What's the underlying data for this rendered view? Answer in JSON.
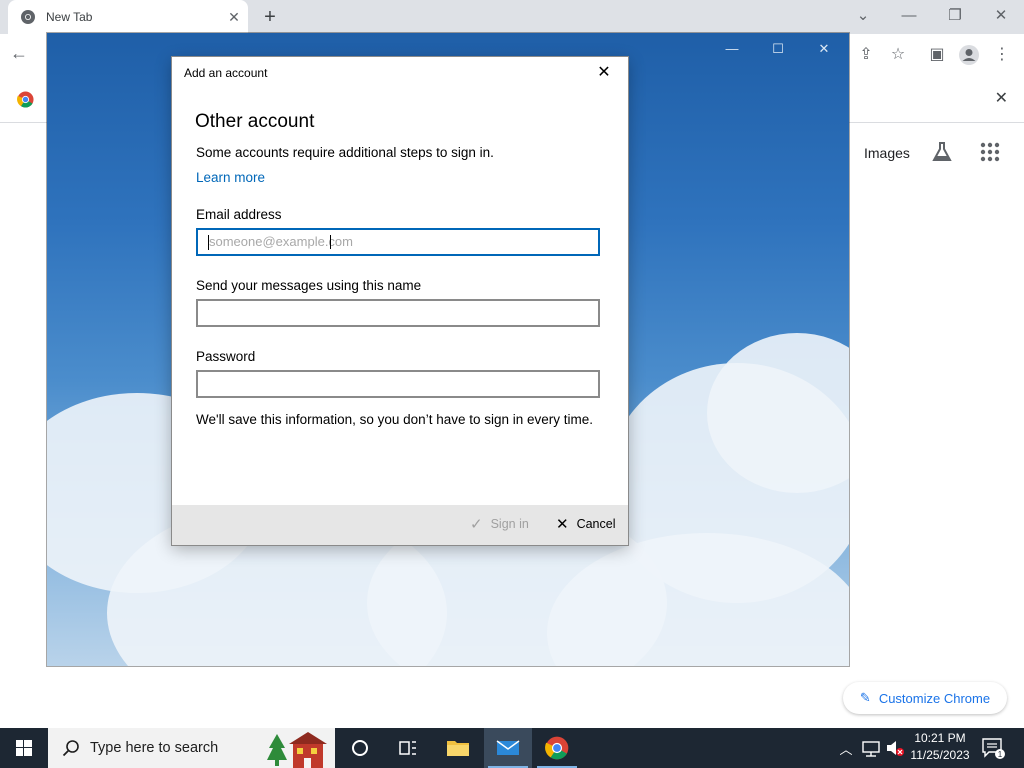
{
  "chrome": {
    "tab_title": "New Tab",
    "new_tab_symbol": "+",
    "ntp_images_label": "Images",
    "customize_label": "Customize Chrome"
  },
  "dialog": {
    "title": "Add an account",
    "heading": "Other account",
    "description": "Some accounts require additional steps to sign in.",
    "learn_more": "Learn more",
    "email_label": "Email address",
    "email_placeholder": "someone@example.com",
    "email_value": "",
    "name_label": "Send your messages using this name",
    "name_value": "",
    "password_label": "Password",
    "password_value": "",
    "save_note": "We'll save this information, so you don’t have to sign in every time.",
    "signin_label": "Sign in",
    "cancel_label": "Cancel"
  },
  "taskbar": {
    "search_placeholder": "Type here to search",
    "time": "10:21 PM",
    "date": "11/25/2023",
    "notification_count": "1"
  },
  "colors": {
    "accent": "#0067b8",
    "chrome_blue": "#1a73e8",
    "taskbar_bg": "#1d2733"
  },
  "icons": [
    "chrome-icon",
    "close-icon",
    "plus-icon",
    "minimize-icon",
    "maximize-icon",
    "back-arrow-icon",
    "share-icon",
    "star-icon",
    "sidebar-icon",
    "profile-icon",
    "menu-icon",
    "labs-icon",
    "apps-grid-icon",
    "pencil-icon",
    "checkmark-icon",
    "windows-start-icon",
    "search-icon",
    "cortana-icon",
    "task-view-icon",
    "file-explorer-icon",
    "mail-icon",
    "chevron-up-icon",
    "network-icon",
    "volume-muted-icon",
    "notification-icon"
  ]
}
